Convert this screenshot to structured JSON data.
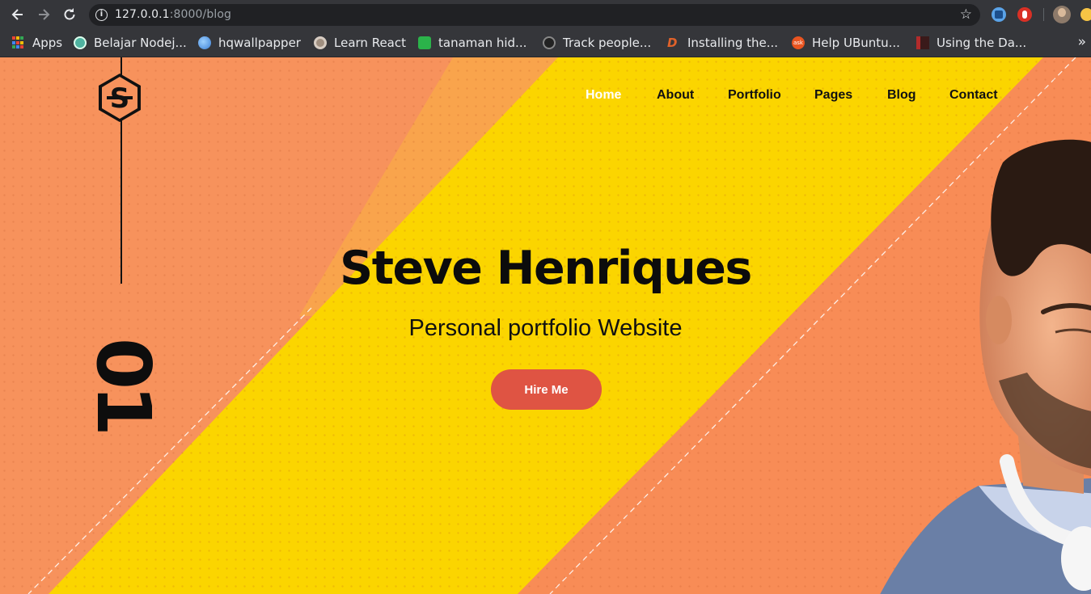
{
  "browser": {
    "url_host": "127.0.0.1",
    "url_path": ":8000/blog",
    "back_icon": "arrow-left-icon",
    "forward_icon": "arrow-right-icon",
    "reload_icon": "reload-icon",
    "bookmark_star_icon": "star-icon"
  },
  "bookmarks": [
    {
      "label": "Apps",
      "icon": "apps-grid-icon"
    },
    {
      "label": "Belajar Nodej...",
      "icon": "globe-icon",
      "color": "#4fb3a0"
    },
    {
      "label": "hqwallpapper",
      "icon": "sphere-icon",
      "color": "#3b7fd6"
    },
    {
      "label": "Learn React",
      "icon": "react-icon",
      "color": "#a08f80"
    },
    {
      "label": "tanaman hid...",
      "icon": "leaf-icon",
      "color": "#2bb34a"
    },
    {
      "label": "Track people...",
      "icon": "tracker-icon",
      "color": "#222222"
    },
    {
      "label": "Installing the...",
      "icon": "d-logo-icon",
      "color": "#e0622a"
    },
    {
      "label": "Help UBuntu...",
      "icon": "ask-icon",
      "color": "#e95420"
    },
    {
      "label": "Using the Da...",
      "icon": "dashboard-icon",
      "color": "#b22b2b"
    }
  ],
  "site": {
    "nav": [
      "Home",
      "About",
      "Portfolio",
      "Pages",
      "Blog",
      "Contact"
    ],
    "active_nav": "Home",
    "slide_number": "01",
    "title": "Steve Henriques",
    "subtitle": "Personal portfolio Website",
    "cta": "Hire Me",
    "logo_letter": "S",
    "colors": {
      "orange": "#f7925c",
      "yellow": "#fbd500",
      "button": "#df5443"
    }
  }
}
